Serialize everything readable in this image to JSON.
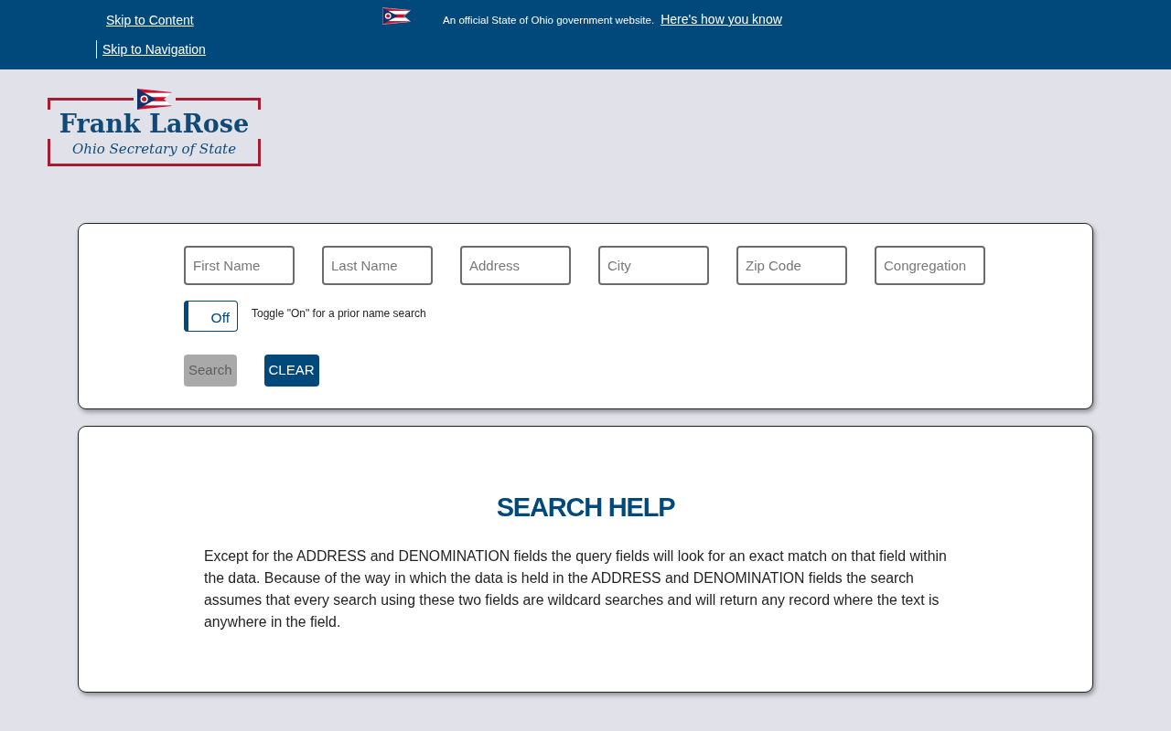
{
  "top_bar": {
    "skip_links": [
      "Skip to Content",
      "Skip to Navigation"
    ],
    "official_notice": "An official State of Ohio government website.",
    "how_you_know_link": "Here's how you know"
  },
  "logo": {
    "name": "Frank LaRose",
    "office": "Ohio Secretary of State"
  },
  "search_form": {
    "fields": [
      {
        "placeholder": "First Name"
      },
      {
        "placeholder": "Last Name"
      },
      {
        "placeholder": "Address"
      },
      {
        "placeholder": "City"
      },
      {
        "placeholder": "Zip Code"
      },
      {
        "placeholder": "Congregation"
      }
    ],
    "prior_name_toggle": {
      "label": "Off",
      "on": false,
      "description": "Toggle \"On\" for a prior name search"
    },
    "buttons": [
      {
        "label": "Search",
        "disabled": true
      },
      {
        "label": "CLEAR",
        "disabled": false
      }
    ]
  },
  "search_help": {
    "title": "SEARCH HELP",
    "text": "Except for the ADDRESS and DENOMINATION fields the query fields will look for an exact match on that field within the data. Because of the way in which the data is held in the ADDRESS and DENOMINATION fields the search assumes that every search using these two fields are wildcard searches and will return any record where the text is anywhere in the field."
  }
}
